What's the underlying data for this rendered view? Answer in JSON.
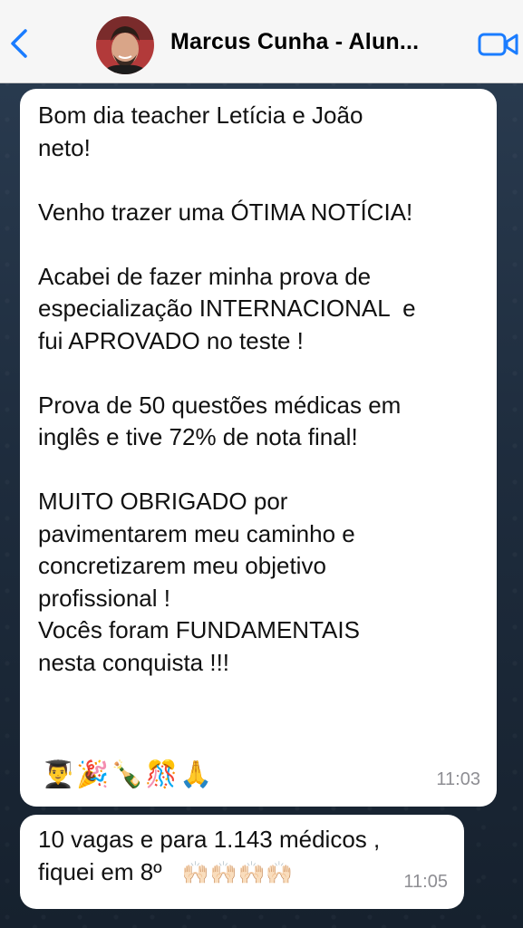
{
  "header": {
    "back_icon": "chevron-left-icon",
    "contact_name": "Marcus Cunha - Alun...",
    "video_icon": "video-camera-icon",
    "accent_color": "#1a7cff"
  },
  "messages": [
    {
      "text": "Bom dia teacher Letícia e João\nneto!\n\nVenho trazer uma ÓTIMA NOTÍCIA!\n\nAcabei de fazer minha prova de\nespecialização INTERNACIONAL  e\nfui APROVADO no teste !\n\nProva de 50 questões médicas em\ninglês e tive 72% de nota final!\n\nMUITO OBRIGADO por\npavimentarem meu caminho e\nconcretizarem meu objetivo\nprofissional !\nVocês foram FUNDAMENTAIS\nnesta conquista !!!",
      "emojis": "👨‍🎓🎉🍾🎊🙏",
      "time": "11:03"
    },
    {
      "text": "10 vagas e para 1.143 médicos ,\nfiquei em 8º",
      "emojis": "🙌🏻🙌🏻🙌🏻🙌🏻",
      "time": "11:05"
    }
  ]
}
